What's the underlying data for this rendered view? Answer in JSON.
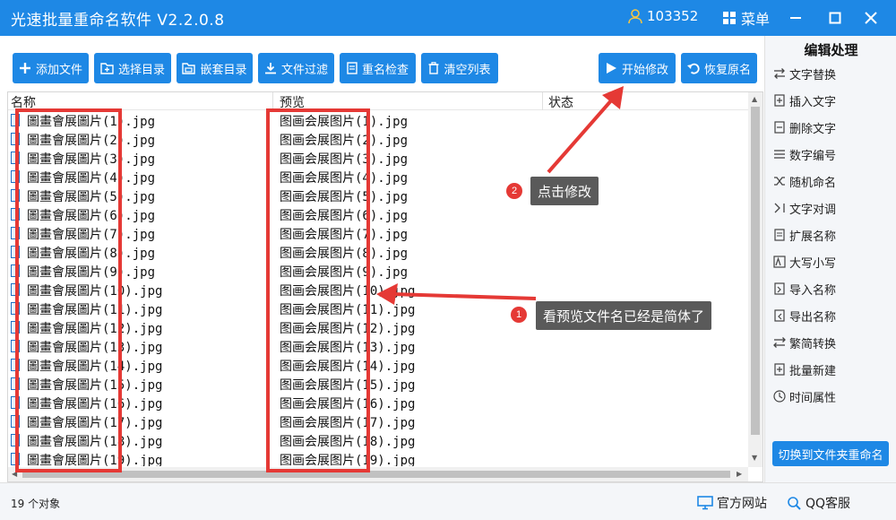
{
  "window": {
    "title": "光速批量重命名软件 V2.2.0.8",
    "user_id": "103352",
    "menu_label": "菜单"
  },
  "toolbar": {
    "add_file": "添加文件",
    "select_dir": "选择目录",
    "nested_dir": "嵌套目录",
    "file_filter": "文件过滤",
    "rename_check": "重名检查",
    "clear_list": "清空列表",
    "start_modify": "开始修改",
    "restore_name": "恢复原名"
  },
  "list": {
    "headers": {
      "name": "名称",
      "preview": "预览",
      "status": "状态"
    },
    "rows": [
      {
        "orig": "圖畫會展圖片(1).jpg",
        "preview": "图画会展图片(1).jpg"
      },
      {
        "orig": "圖畫會展圖片(2).jpg",
        "preview": "图画会展图片(2).jpg"
      },
      {
        "orig": "圖畫會展圖片(3).jpg",
        "preview": "图画会展图片(3).jpg"
      },
      {
        "orig": "圖畫會展圖片(4).jpg",
        "preview": "图画会展图片(4).jpg"
      },
      {
        "orig": "圖畫會展圖片(5).jpg",
        "preview": "图画会展图片(5).jpg"
      },
      {
        "orig": "圖畫會展圖片(6).jpg",
        "preview": "图画会展图片(6).jpg"
      },
      {
        "orig": "圖畫會展圖片(7).jpg",
        "preview": "图画会展图片(7).jpg"
      },
      {
        "orig": "圖畫會展圖片(8).jpg",
        "preview": "图画会展图片(8).jpg"
      },
      {
        "orig": "圖畫會展圖片(9).jpg",
        "preview": "图画会展图片(9).jpg"
      },
      {
        "orig": "圖畫會展圖片(10).jpg",
        "preview": "图画会展图片(10).jpg"
      },
      {
        "orig": "圖畫會展圖片(11).jpg",
        "preview": "图画会展图片(11).jpg"
      },
      {
        "orig": "圖畫會展圖片(12).jpg",
        "preview": "图画会展图片(12).jpg"
      },
      {
        "orig": "圖畫會展圖片(13).jpg",
        "preview": "图画会展图片(13).jpg"
      },
      {
        "orig": "圖畫會展圖片(14).jpg",
        "preview": "图画会展图片(14).jpg"
      },
      {
        "orig": "圖畫會展圖片(15).jpg",
        "preview": "图画会展图片(15).jpg"
      },
      {
        "orig": "圖畫會展圖片(16).jpg",
        "preview": "图画会展图片(16).jpg"
      },
      {
        "orig": "圖畫會展圖片(17).jpg",
        "preview": "图画会展图片(17).jpg"
      },
      {
        "orig": "圖畫會展圖片(18).jpg",
        "preview": "图画会展图片(18).jpg"
      },
      {
        "orig": "圖畫會展圖片(19).jpg",
        "preview": "图画会展图片(19).jpg"
      }
    ]
  },
  "annotations": {
    "callout_1_num": "1",
    "callout_1_text": "看预览文件名已经是简体了",
    "callout_2_num": "2",
    "callout_2_text": "点击修改"
  },
  "sidepanel": {
    "title": "编辑处理",
    "items": [
      {
        "label": "文字替换",
        "icon": "text-replace-icon"
      },
      {
        "label": "插入文字",
        "icon": "insert-text-icon"
      },
      {
        "label": "删除文字",
        "icon": "delete-text-icon"
      },
      {
        "label": "数字编号",
        "icon": "number-icon"
      },
      {
        "label": "随机命名",
        "icon": "shuffle-icon"
      },
      {
        "label": "文字对调",
        "icon": "swap-text-icon"
      },
      {
        "label": "扩展名称",
        "icon": "extension-icon"
      },
      {
        "label": "大写小写",
        "icon": "case-icon"
      },
      {
        "label": "导入名称",
        "icon": "import-icon"
      },
      {
        "label": "导出名称",
        "icon": "export-icon"
      },
      {
        "label": "繁简转换",
        "icon": "convert-icon"
      },
      {
        "label": "批量新建",
        "icon": "batch-new-icon"
      },
      {
        "label": "时间属性",
        "icon": "clock-icon"
      }
    ],
    "switch_button": "切换到文件夹重命名"
  },
  "statusbar": {
    "object_count": "19 个对象",
    "website": "官方网站",
    "qq_service": "QQ客服"
  },
  "colors": {
    "primary": "#1e88e5",
    "highlight": "#e53935",
    "callout_bg": "#5a5a5a"
  }
}
